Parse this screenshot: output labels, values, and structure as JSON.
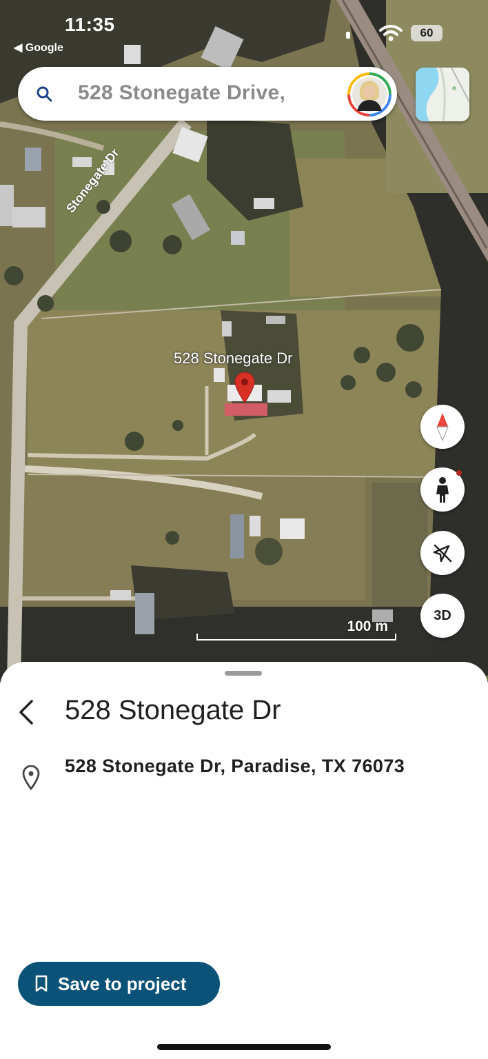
{
  "status_bar": {
    "time": "11:35",
    "back_app": "◀ Google",
    "battery": "60"
  },
  "search": {
    "query": "528 Stonegate Drive,"
  },
  "map": {
    "road_label": "Stonegate Dr",
    "place_label": "528 Stonegate Dr",
    "scale_label": "100 m",
    "buttons": {
      "three_d": "3D"
    }
  },
  "sheet": {
    "title": "528 Stonegate Dr",
    "address": "528 Stonegate Dr, Paradise, TX 76073",
    "save_button": "Save to project"
  },
  "colors": {
    "primary_button": "#0b5278",
    "pin": "#d93025",
    "compass_north": "#e8453c"
  },
  "icons": [
    "search-icon",
    "wifi-icon",
    "signal-icon",
    "map-layers-icon",
    "compass-icon",
    "pegman-icon",
    "location-off-icon",
    "back-chevron-icon",
    "location-pin-icon",
    "bookmark-icon"
  ]
}
